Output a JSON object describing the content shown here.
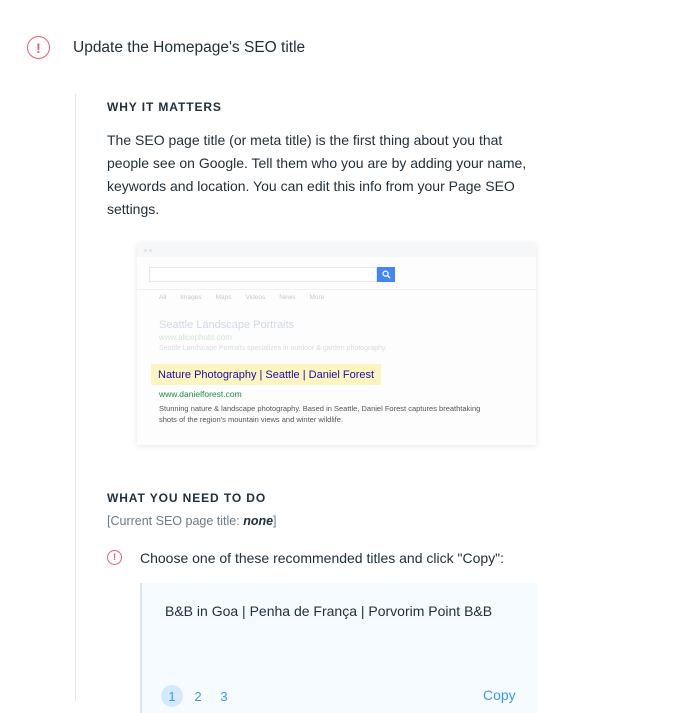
{
  "task": {
    "alert_glyph": "!",
    "title": "Update the Homepage's SEO title"
  },
  "why": {
    "heading": "WHY IT MATTERS",
    "body": "The SEO page title (or meta title) is the first thing about you that people see on Google. Tell them who you are by adding your name, keywords and location. You can edit this info from your Page SEO settings."
  },
  "preview": {
    "tabs": [
      "All",
      "Images",
      "Maps",
      "Videos",
      "News",
      "More"
    ],
    "faded_result": {
      "title": "Seattle Landscape Portraits",
      "url": "www.alicephoto.com",
      "desc": "Seattle Landscape Portraits specializes in outdoor & garden photography."
    },
    "highlight_result": {
      "title": "Nature Photography | Seattle | Daniel Forest",
      "url": "www.danielforest.com",
      "desc": "Stunning nature & landscape photography. Based in Seattle, Daniel Forest captures breathtaking shots of the region's mountain views and winter wildlife."
    },
    "colors": {
      "search_button": "#4285f4",
      "highlight": "#fdf5c0",
      "link": "#1a0dab",
      "url": "#1e8e3e"
    }
  },
  "todo": {
    "heading": "WHAT YOU NEED TO DO",
    "current_prefix": "[Current SEO page title: ",
    "current_value": "none",
    "current_suffix": "]",
    "step_glyph": "!",
    "step_text": "Choose one of these recommended titles and click \"Copy\":"
  },
  "recommendation": {
    "title": "B&B in Goa | Penha de França | Porvorim Point B&B",
    "pages": [
      "1",
      "2",
      "3"
    ],
    "active_page": "1",
    "copy_label": "Copy"
  },
  "colors": {
    "alert": "#ee5a6f",
    "accent": "#3899ec",
    "text": "#20303c"
  }
}
